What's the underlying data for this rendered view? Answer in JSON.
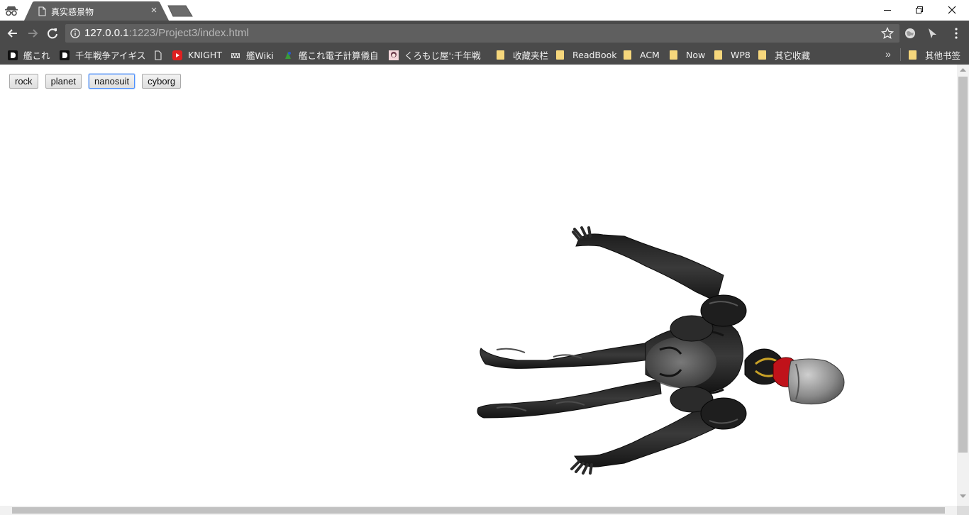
{
  "tab": {
    "title": "真实感景物"
  },
  "address": {
    "host": "127.0.0.1",
    "path": ":1223/Project3/index.html"
  },
  "bookmarks": [
    {
      "label": "艦これ",
      "icon": "black-d-icon"
    },
    {
      "label": "千年戦争アイギス",
      "icon": "black-d-icon"
    },
    {
      "label": "",
      "icon": "page-icon"
    },
    {
      "label": "KNIGHT",
      "icon": "red-logo-icon"
    },
    {
      "label": "艦Wiki",
      "icon": "wiki-icon"
    },
    {
      "label": "艦これ電子計算儀自",
      "icon": "green-icon"
    },
    {
      "label": "くろもじ屋':千年戦",
      "icon": "avatar-icon"
    },
    {
      "label": "收藏夹栏",
      "icon": "folder-icon"
    },
    {
      "label": "ReadBook",
      "icon": "folder-icon"
    },
    {
      "label": "ACM",
      "icon": "folder-icon"
    },
    {
      "label": "Now",
      "icon": "folder-icon"
    },
    {
      "label": "WP8",
      "icon": "folder-icon"
    },
    {
      "label": "其它收藏",
      "icon": "folder-icon"
    }
  ],
  "other_bookmarks": "其他书签",
  "more_glyph": "»",
  "page": {
    "buttons": [
      "rock",
      "planet",
      "nanosuit",
      "cyborg"
    ],
    "selected": "nanosuit",
    "model": "nanosuit"
  },
  "colors": {
    "chrome": "#4a4a4a",
    "tab": "#5f5f5f",
    "folder": "#f6d77c",
    "suit_dark": "#262626",
    "suit_accent": "#c0121a"
  }
}
